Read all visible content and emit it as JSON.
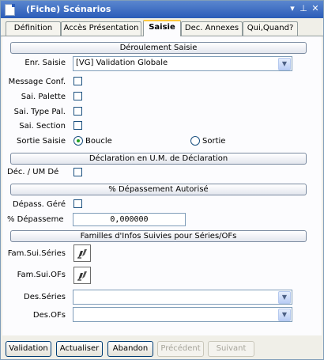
{
  "window": {
    "title": "(Fiche) Scénarios"
  },
  "tabs": [
    {
      "label": "Définition"
    },
    {
      "label": "Accès Présentation"
    },
    {
      "label": "Saisie"
    },
    {
      "label": "Dec. Annexes"
    },
    {
      "label": "Qui,Quand?"
    }
  ],
  "sections": {
    "deroulement": "Déroulement Saisie",
    "declaration": "Déclaration en U.M. de Déclaration",
    "depassement": "% Dépassement Autorisé",
    "familles": "Familles d'Infos Suivies pour Séries/OFs"
  },
  "fields": {
    "enr_saisie_label": "Enr. Saisie",
    "enr_saisie_value": "[VG] Validation Globale",
    "message_conf_label": "Message Conf.",
    "sai_palette_label": "Sai. Palette",
    "sai_type_pal_label": "Sai. Type Pal.",
    "sai_section_label": "Sai. Section",
    "sortie_saisie_label": "Sortie Saisie",
    "radio_boucle": "Boucle",
    "radio_sortie": "Sortie",
    "dec_um_label": "Déc. / UM Dé",
    "depass_gere_label": "Dépass. Géré",
    "pct_depassement_label": "% Dépasseme",
    "pct_depassement_value": "0,000000",
    "fam_sui_series_label": "Fam.Sui.Séries",
    "fam_sui_ofs_label": "Fam.Sui.OFs",
    "des_series_label": "Des.Séries",
    "des_ofs_label": "Des.OFs"
  },
  "buttons": {
    "validation": "Validation",
    "actualiser": "Actualiser",
    "abandon": "Abandon",
    "precedent": "Précédent",
    "suivant": "Suivant"
  },
  "icons": {
    "title": [
      "document-icon",
      "dropdown-icon",
      "pin-icon",
      "close-icon"
    ],
    "family": "family-edit-icon"
  }
}
